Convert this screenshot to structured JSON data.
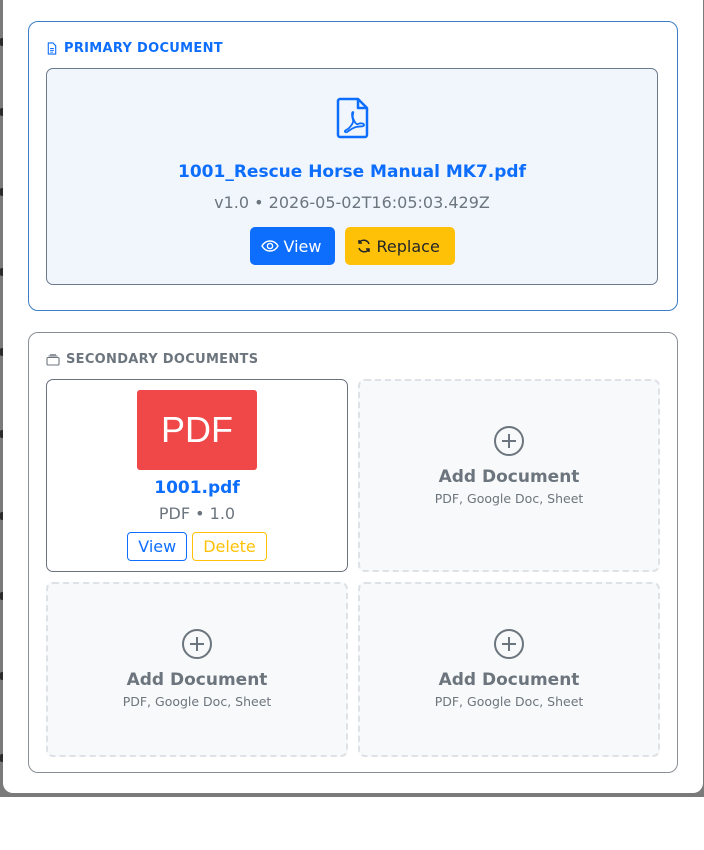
{
  "primary": {
    "header": "PRIMARY DOCUMENT",
    "filename": "1001_Rescue Horse Manual MK7.pdf",
    "meta": "v1.0 • 2026-05-02T16:05:03.429Z",
    "view_label": "View",
    "replace_label": "Replace"
  },
  "secondary": {
    "header": "SECONDARY DOCUMENTS",
    "documents": [
      {
        "badge": "PDF",
        "filename": "1001.pdf",
        "meta": "PDF • 1.0",
        "view_label": "View",
        "delete_label": "Delete"
      }
    ],
    "slots": [
      {
        "label": "Add Document",
        "sub": "PDF, Google Doc, Sheet"
      },
      {
        "label": "Add Document",
        "sub": "PDF, Google Doc, Sheet"
      },
      {
        "label": "Add Document",
        "sub": "PDF, Google Doc, Sheet"
      }
    ]
  },
  "colors": {
    "primary": "#0d6efd",
    "warning": "#ffc107",
    "muted": "#6c757d",
    "pdf_badge": "#f04848"
  },
  "icons": {
    "primary_header": "file-text-icon",
    "secondary_header": "folders-icon",
    "primary_file": "file-pdf-icon",
    "view": "eye-icon",
    "replace": "refresh-icon",
    "add": "plus-circle-icon"
  }
}
